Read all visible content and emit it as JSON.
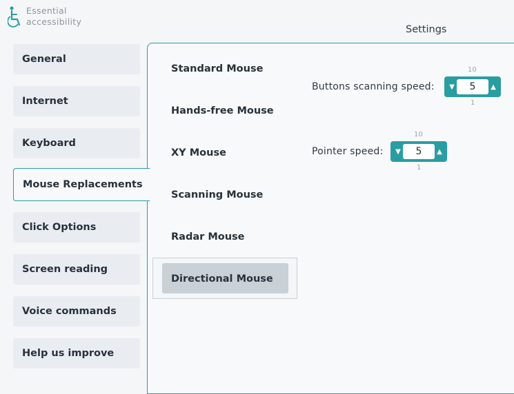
{
  "app": {
    "name_line1": "Essential",
    "name_line2": "accessibility",
    "title": "Settings"
  },
  "sidebar": {
    "items": [
      {
        "label": "General"
      },
      {
        "label": "Internet"
      },
      {
        "label": "Keyboard"
      },
      {
        "label": "Mouse Replacements",
        "active": true
      },
      {
        "label": "Click Options"
      },
      {
        "label": "Screen reading"
      },
      {
        "label": "Voice commands"
      },
      {
        "label": "Help us improve"
      }
    ]
  },
  "submenu": {
    "items": [
      {
        "label": "Standard Mouse"
      },
      {
        "label": "Hands-free Mouse"
      },
      {
        "label": "XY Mouse"
      },
      {
        "label": "Scanning Mouse"
      },
      {
        "label": "Radar Mouse"
      },
      {
        "label": "Directional Mouse",
        "selected": true
      }
    ]
  },
  "settings": {
    "buttons_scanning_speed": {
      "label": "Buttons scanning speed:",
      "value": "5",
      "max": "10",
      "min": "1"
    },
    "pointer_speed": {
      "label": "Pointer speed:",
      "value": "5",
      "max": "10",
      "min": "1"
    }
  },
  "colors": {
    "accent": "#2a9da3",
    "selected_bg": "#c9d0d6"
  },
  "icons": {
    "logo": "wheelchair-accessibility-icon",
    "decrease": "triangle-down-icon",
    "increase": "triangle-up-icon"
  }
}
